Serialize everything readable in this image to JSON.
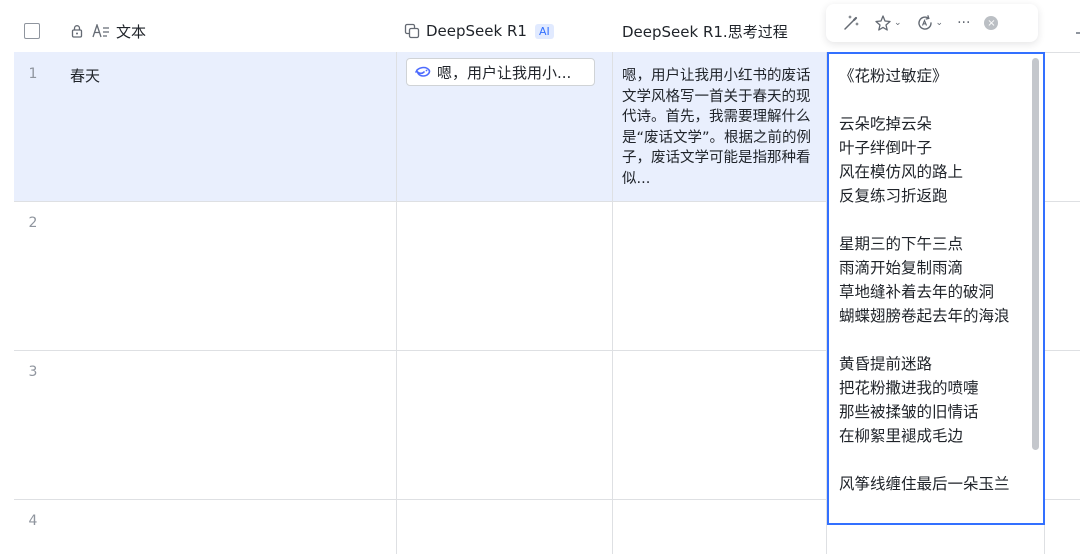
{
  "header": {
    "col_text_label": "文本",
    "col_r1_label": "DeepSeek R1",
    "col_r1_badge": "AI",
    "col_think_label": "DeepSeek R1.思考过程"
  },
  "rows": [
    {
      "num": "1",
      "text": "春天",
      "r1_preview": "嗯，用户让我用小...",
      "think": "嗯，用户让我用小红书的废话文学风格写一首关于春天的现代诗。首先，我需要理解什么是“废话文学”。根据之前的例子，废话文学可能是指那种看似..."
    },
    {
      "num": "2",
      "text": "",
      "r1_preview": "",
      "think": ""
    },
    {
      "num": "3",
      "text": "",
      "r1_preview": "",
      "think": ""
    },
    {
      "num": "4",
      "text": "",
      "r1_preview": "",
      "think": ""
    }
  ],
  "popup": {
    "content": "《花粉过敏症》\n\n云朵吃掉云朵\n叶子绊倒叶子\n风在模仿风的路上\n反复练习折返跑\n\n星期三的下午三点\n雨滴开始复制雨滴\n草地缝补着去年的破洞\n蝴蝶翅膀卷起去年的海浪\n\n黄昏提前迷路\n把花粉撒进我的喷嚏\n那些被揉皱的旧情话\n在柳絮里褪成毛边\n\n风筝线缠住最后一朵玉兰"
  },
  "toolbar": {
    "more_label": "···",
    "close_label": "×",
    "caret": "⌄"
  },
  "colors": {
    "accent": "#3370ff",
    "selected_row": "#e9effd",
    "grid_line": "#dee0e3"
  }
}
